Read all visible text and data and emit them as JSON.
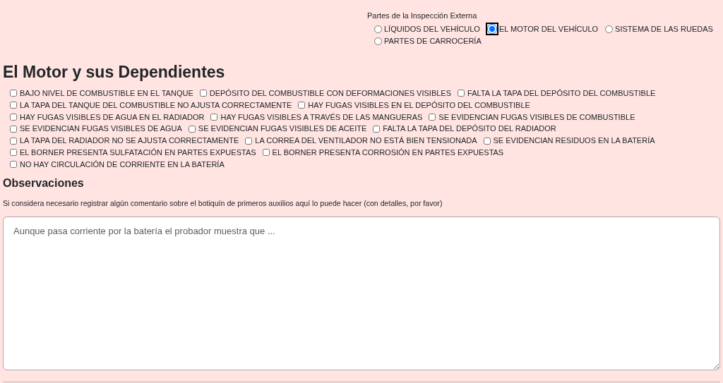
{
  "inspection_parts": {
    "label": "Partes de la Inspección Externa",
    "options": [
      {
        "label": "LÍQUIDOS DEL VEHÍCULO",
        "selected": false
      },
      {
        "label": "EL MOTOR DEL VEHÍCULO",
        "selected": true
      },
      {
        "label": "SISTEMA DE LAS RUEDAS",
        "selected": false
      },
      {
        "label": "PARTES DE CARROCERÍA",
        "selected": false
      }
    ]
  },
  "section_title": "El Motor y sus Dependientes",
  "checks": [
    {
      "label": "BAJO NIVEL DE COMBUSTIBLE EN EL TANQUE",
      "checked": false
    },
    {
      "label": "DEPÓSITO DEL COMBUSTIBLE CON DEFORMACIONES VISIBLES",
      "checked": false
    },
    {
      "label": "FALTA LA TAPA DEL DEPÓSITO DEL COMBUSTIBLE",
      "checked": false
    },
    {
      "label": "LA TAPA DEL TANQUE DEL COMBUSTIBLE NO AJUSTA CORRECTAMENTE",
      "checked": false
    },
    {
      "label": "HAY FUGAS VISIBLES EN EL DEPÓSITO DEL COMBUSTIBLE",
      "checked": false
    },
    {
      "label": "HAY FUGAS VISIBLES DE AGUA EN EL RADIADOR",
      "checked": false
    },
    {
      "label": "HAY FUGAS VISIBLES A TRAVÉS DE LAS MANGUERAS",
      "checked": false
    },
    {
      "label": "SE EVIDENCIAN FUGAS VISIBLES DE COMBUSTIBLE",
      "checked": false
    },
    {
      "label": "SE EVIDENCIAN FUGAS VISIBLES DE AGUA",
      "checked": false
    },
    {
      "label": "SE EVIDENCIAN FUGAS VISIBLES DE ACEITE",
      "checked": false
    },
    {
      "label": "FALTA LA TAPA DEL DEPÓSITO DEL RADIADOR",
      "checked": false
    },
    {
      "label": "LA TAPA DEL RADIADOR NO SE AJUSTA CORRECTAMENTE",
      "checked": false
    },
    {
      "label": "LA CORREA DEL VENTILADOR NO ESTÁ BIEN TENSIONADA",
      "checked": false
    },
    {
      "label": "SE EVIDENCIAN RESIDUOS EN LA BATERÍA",
      "checked": false
    },
    {
      "label": "EL BORNER PRESENTA SULFATACIÓN EN PARTES EXPUESTAS",
      "checked": false
    },
    {
      "label": "EL BORNER PRESENTA CORROSIÓN EN PARTES EXPUESTAS",
      "checked": false
    },
    {
      "label": "NO HAY CIRCULACIÓN DE CORRIENTE EN LA BATERÍA",
      "checked": false
    }
  ],
  "observations": {
    "title": "Observaciones",
    "hint": "Si considera necesario registrar algún comentario sobre el botiquín de primeros auxilios aquí lo puede hacer (con detalles, por favor)",
    "placeholder": "Aunque pasa corriente por la batería el probador muestra que ..."
  }
}
